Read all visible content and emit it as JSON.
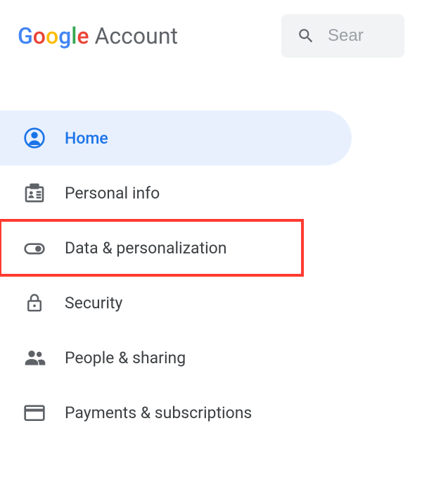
{
  "header": {
    "logo_text": "Google",
    "account_text": "Account"
  },
  "search": {
    "placeholder": "Sear"
  },
  "sidebar": {
    "items": [
      {
        "label": "Home",
        "active": true
      },
      {
        "label": "Personal info"
      },
      {
        "label": "Data & personalization",
        "highlighted": true
      },
      {
        "label": "Security"
      },
      {
        "label": "People & sharing"
      },
      {
        "label": "Payments & subscriptions"
      }
    ]
  }
}
